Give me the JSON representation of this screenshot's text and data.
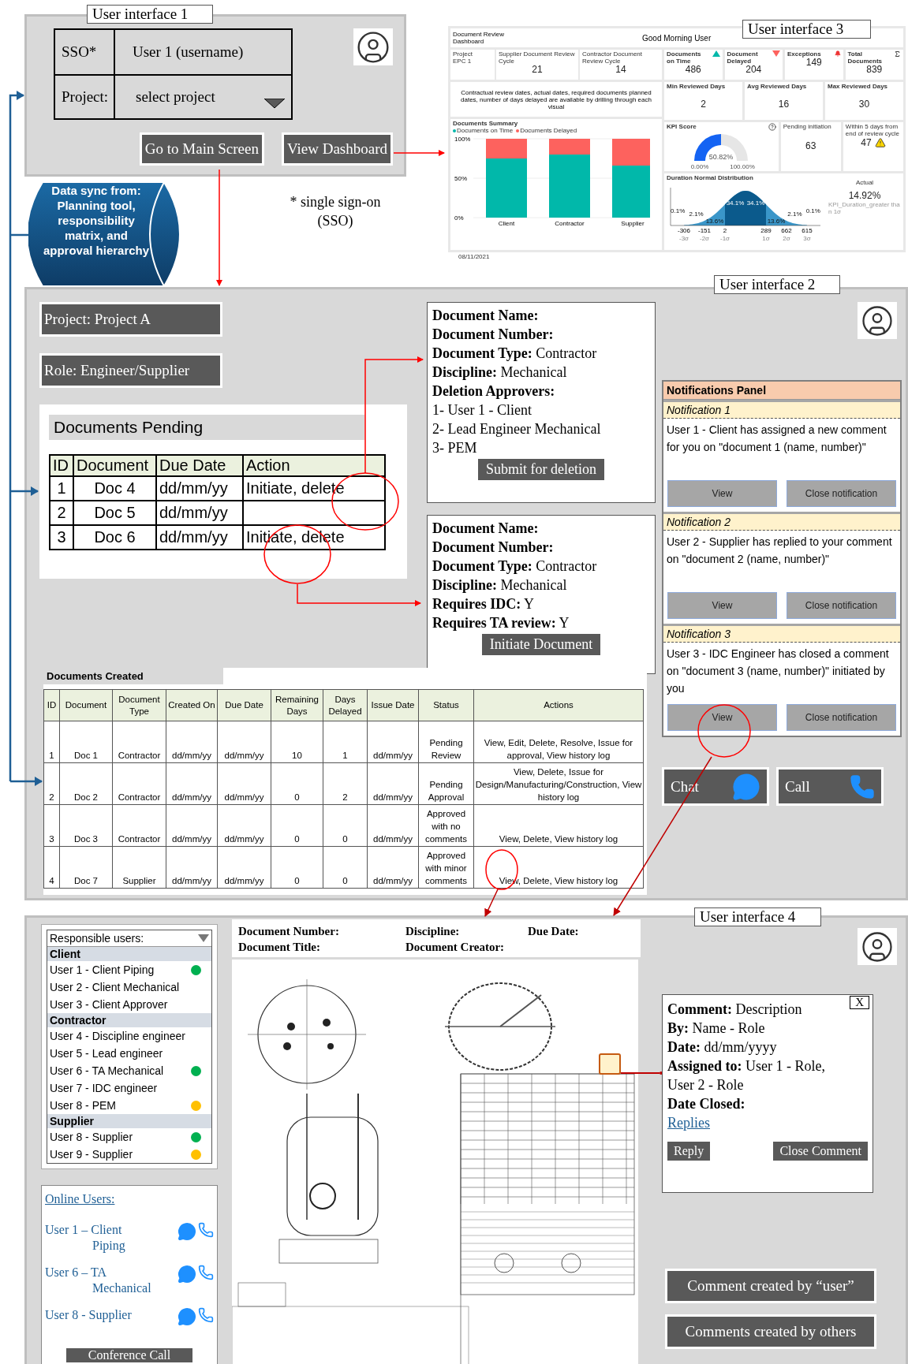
{
  "ui1": {
    "label": "User interface 1",
    "sso_label": "SSO*",
    "sso_value": "User 1 (username)",
    "project_label": "Project:",
    "project_placeholder": "select project",
    "buttons": [
      "Go to Main Screen",
      "View Dashboard"
    ]
  },
  "data_sync": "Data sync from: Planning tool, responsibility matrix, and approval hierarchy",
  "sso_note": "* single sign-on (SSO)",
  "ui3": {
    "label": "User interface 3",
    "title": "Document Review Dashboard",
    "greeting": "Good Morning User",
    "project": {
      "label": "Project",
      "value": "EPC 1"
    },
    "cycles": [
      {
        "label": "Supplier Document Review Cycle",
        "value": "21"
      },
      {
        "label": "Contractor Document Review Cycle",
        "value": "14"
      }
    ],
    "kpis": [
      {
        "label": "Documents on Time",
        "value": "486",
        "kind": "up"
      },
      {
        "label": "Document Delayed",
        "value": "204",
        "kind": "down"
      },
      {
        "label": "Exceptions",
        "value": "149",
        "kind": "alert"
      },
      {
        "label": "Total Documents",
        "value": "839",
        "kind": "sum"
      }
    ],
    "note": "Contractual review dates, actual dates, required documents planned dates, number of days delayed are available by drilling through each visual",
    "days": [
      {
        "label": "Min Reviewed Days",
        "value": "2"
      },
      {
        "label": "Avg Reviewed Days",
        "value": "16"
      },
      {
        "label": "Max Reviewed Days",
        "value": "30"
      }
    ],
    "summary": {
      "title": "Documents Summary",
      "chart_data": {
        "type": "bar",
        "stacked": true,
        "categories": [
          "Client",
          "Contractor",
          "Supplier"
        ],
        "series": [
          {
            "name": "Documents on Time",
            "color": "#01b8aa",
            "values": [
              75,
              80,
              66
            ]
          },
          {
            "name": "Documents Delayed",
            "color": "#fd625e",
            "values": [
              25,
              20,
              34
            ]
          }
        ],
        "ylim": [
          0,
          100
        ],
        "yticks": [
          {
            "value": 0,
            "label": "0%"
          },
          {
            "value": 50,
            "label": "50%"
          },
          {
            "value": 100,
            "label": "100%"
          }
        ]
      }
    },
    "kpi_score": {
      "title": "KPI Score",
      "value": "50.82%",
      "min": "0.00%",
      "max": "100.00%"
    },
    "pending": {
      "label": "Pending initiation",
      "value": "63"
    },
    "within": {
      "label": "Within 5 days from end of review cycle",
      "value": "47"
    },
    "distribution": {
      "title": "Duration Normal Distribution",
      "actual_label": "Actual",
      "actual_value": "14.92%",
      "actual_caption": "KPI_Duration_greater than 1σ",
      "x_labels": [
        "-306",
        "-151",
        "2",
        "289",
        "662",
        "615"
      ],
      "sigma_labels": [
        "-3σ",
        "-2σ",
        "-1σ",
        "1σ",
        "2σ",
        "3σ"
      ],
      "band_labels": [
        "0.1%",
        "2.1%",
        "13.6%",
        "34.1%",
        "34.1%",
        "13.6%",
        "2.1%",
        "0.1%"
      ]
    },
    "date": "08/11/2021"
  },
  "ui2": {
    "label": "User interface 2",
    "project": "Project: Project A",
    "role": "Role: Engineer/Supplier",
    "pending": {
      "title": "Documents Pending",
      "columns": [
        "ID",
        "Document",
        "Due Date",
        "Action"
      ],
      "rows": [
        {
          "id": "1",
          "document": "Doc 4",
          "due": "dd/mm/yy",
          "action": "Initiate, delete"
        },
        {
          "id": "2",
          "document": "Doc 5",
          "due": "dd/mm/yy"
        },
        {
          "id": "3",
          "document": "Doc 6",
          "due": "dd/mm/yy",
          "action": "Initiate, delete"
        }
      ]
    },
    "doc_boxes": [
      {
        "lines": [
          "**Document Name:**",
          "**Document Number:**",
          "**Document Type:** Contractor",
          "**Discipline:** Mechanical",
          "**Deletion Approvers:**",
          "1- User 1 - Client",
          "2- Lead Engineer Mechanical",
          "3- PEM"
        ],
        "button": "Submit for deletion"
      },
      {
        "lines": [
          "**Document Name:**",
          "**Document Number:**",
          "**Document Type:** Contractor",
          "**Discipline:** Mechanical",
          "**Requires IDC:** Y",
          "**Requires TA review:** Y"
        ],
        "button": "Initiate Document"
      }
    ],
    "notifications": {
      "title": "Notifications Panel",
      "items": [
        {
          "title": "Notification 1",
          "text": "User 1 - Client has assigned a new comment for you on \"document 1 (name, number)\"",
          "buttons": [
            "View",
            "Close notification"
          ]
        },
        {
          "title": "Notification 2",
          "text": "User 2 - Supplier has replied to your comment on \"document 2 (name, number)\"",
          "buttons": [
            "View",
            "Close notification"
          ]
        },
        {
          "title": "Notification 3",
          "text": "User 3 - IDC Engineer has closed a comment on \"document 3 (name, number)\" initiated by you",
          "buttons": [
            "View",
            "Close notification"
          ]
        }
      ]
    },
    "contact_buttons": [
      {
        "label": "Chat",
        "kind": "chat"
      },
      {
        "label": "Call",
        "kind": "call"
      }
    ],
    "created": {
      "title": "Documents Created",
      "columns": [
        "ID",
        "Document",
        "Document Type",
        "Created On",
        "Due Date",
        "Remaining Days",
        "Days Delayed",
        "Issue Date",
        "Status",
        "Actions"
      ],
      "rows": [
        [
          "1",
          "Doc 1",
          "Contractor",
          "dd/mm/yy",
          "dd/mm/yy",
          "10",
          "1",
          "dd/mm/yy",
          "Pending Review",
          "View, Edit, Delete, Resolve, Issue for approval, View history log"
        ],
        [
          "2",
          "Doc 2",
          "Contractor",
          "dd/mm/yy",
          "dd/mm/yy",
          "0",
          "2",
          "dd/mm/yy",
          "Pending Approval",
          "View, Delete, Issue for Design/Manufacturing/Construction, View history log"
        ],
        [
          "3",
          "Doc 3",
          "Contractor",
          "dd/mm/yy",
          "dd/mm/yy",
          "0",
          "0",
          "dd/mm/yy",
          "Approved with no comments",
          "View, Delete, View history log"
        ],
        [
          "4",
          "Doc 7",
          "Supplier",
          "dd/mm/yy",
          "dd/mm/yy",
          "0",
          "0",
          "dd/mm/yy",
          "Approved with minor comments",
          "View, Delete, View history log"
        ]
      ]
    }
  },
  "ui4": {
    "label": "User interface 4",
    "responsible": {
      "title": "Responsible users:",
      "groups": [
        {
          "name": "Client",
          "users": [
            {
              "name": "User 1 - Client Piping",
              "color": "#00b050"
            },
            {
              "name": "User 2 - Client Mechanical"
            },
            {
              "name": "User 3 - Client Approver"
            }
          ]
        },
        {
          "name": "Contractor",
          "users": [
            {
              "name": "User 4 - Discipline engineer"
            },
            {
              "name": "User 5 - Lead engineer"
            },
            {
              "name": "User 6 - TA Mechanical",
              "color": "#00b050"
            },
            {
              "name": "User 7 - IDC engineer"
            },
            {
              "name": "User 8 - PEM",
              "color": "#ffc000"
            }
          ]
        },
        {
          "name": "Supplier",
          "users": [
            {
              "name": "User 8 - Supplier",
              "color": "#00b050"
            },
            {
              "name": "User 9 - Supplier",
              "color": "#ffc000"
            }
          ]
        }
      ]
    },
    "online": {
      "title": "Online Users:",
      "users": [
        "User 1 – Client Piping",
        "User 6 – TA Mechanical",
        "User 8 - Supplier"
      ],
      "button": "Conference Call"
    },
    "doc_header": {
      "fields": [
        "Document Number:",
        "Discipline:",
        "Due Date:",
        "Document Title:",
        "Document Creator:"
      ]
    },
    "comment": {
      "close": "X",
      "lines": [
        "**Comment:** Description",
        "**By:** Name - Role",
        "**Date:** dd/mm/yyyy",
        "**Assigned to:** User 1 - Role, User 2 - Role",
        "**Date Closed:**"
      ],
      "link": "Replies",
      "buttons": [
        "Reply",
        "Close Comment"
      ]
    },
    "comment_filters": [
      "Comment created by “user”",
      "Comments created by others"
    ]
  }
}
